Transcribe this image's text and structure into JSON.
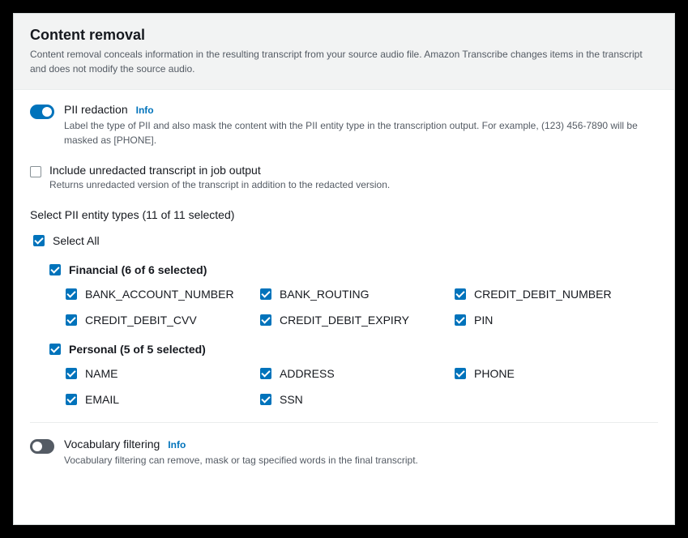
{
  "header": {
    "title": "Content removal",
    "description": "Content removal conceals information in the resulting transcript from your source audio file. Amazon Transcribe changes items in the transcript and does not modify the source audio."
  },
  "piiRedaction": {
    "label": "PII redaction",
    "info": "Info",
    "description": "Label the type of PII and also mask the content with the PII entity type in the transcription output. For example, (123) 456-7890 will be masked as [PHONE]."
  },
  "includeUnredacted": {
    "label": "Include unredacted transcript in job output",
    "description": "Returns unredacted version of the transcript in addition to the redacted version."
  },
  "selectTypesLabel": "Select PII entity types (11 of 11 selected)",
  "selectAll": "Select All",
  "groups": {
    "financial": {
      "title": "Financial (6 of 6 selected)",
      "items": [
        "BANK_ACCOUNT_NUMBER",
        "BANK_ROUTING",
        "CREDIT_DEBIT_NUMBER",
        "CREDIT_DEBIT_CVV",
        "CREDIT_DEBIT_EXPIRY",
        "PIN"
      ]
    },
    "personal": {
      "title": "Personal (5 of 5 selected)",
      "items": [
        "NAME",
        "ADDRESS",
        "PHONE",
        "EMAIL",
        "SSN"
      ]
    }
  },
  "vocabFiltering": {
    "label": "Vocabulary filtering",
    "info": "Info",
    "description": "Vocabulary filtering can remove, mask or tag specified words in the final transcript."
  }
}
